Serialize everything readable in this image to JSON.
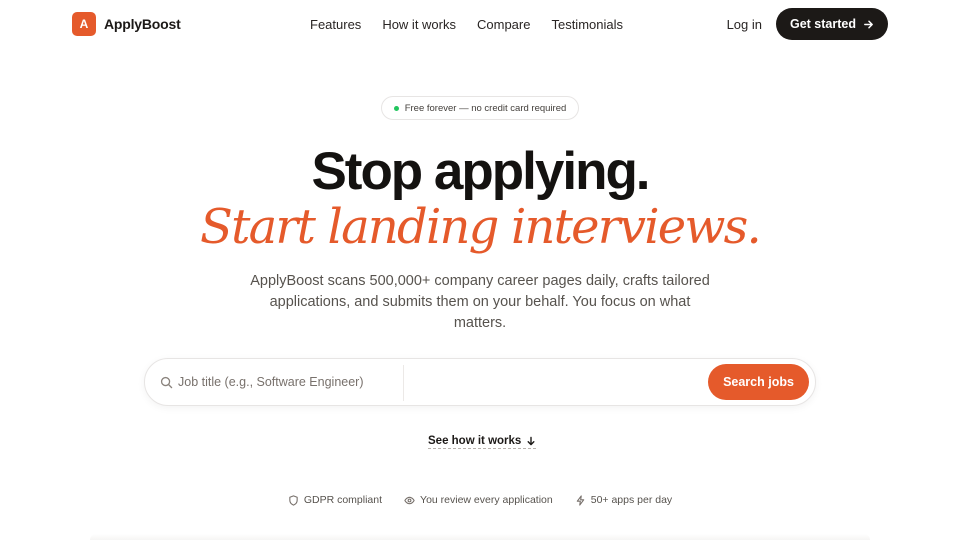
{
  "brand": {
    "mark": "A",
    "name": "ApplyBoost"
  },
  "nav": {
    "links": [
      "Features",
      "How it works",
      "Compare",
      "Testimonials"
    ],
    "login": "Log in",
    "cta": "Get started"
  },
  "badge": {
    "text": "Free forever — no credit card required"
  },
  "hero": {
    "headline": "Stop applying.",
    "headline_accent": "Start landing interviews.",
    "subtitle": "ApplyBoost scans 500,000+ company career pages daily, crafts tailored applications, and submits them on your behalf. You focus on what matters."
  },
  "search": {
    "job_placeholder": "Job title (e.g., Software Engineer)",
    "location_placeholder": "",
    "button": "Search jobs"
  },
  "see_how": "See how it works",
  "trust": [
    {
      "icon": "shield-icon",
      "label": "GDPR compliant"
    },
    {
      "icon": "eye-icon",
      "label": "You review every application"
    },
    {
      "icon": "lightning-icon",
      "label": "50+ apps per day"
    }
  ],
  "colors": {
    "accent": "#e55a2b",
    "dark": "#1c1917",
    "text": "#57534e",
    "success": "#22c55e"
  }
}
